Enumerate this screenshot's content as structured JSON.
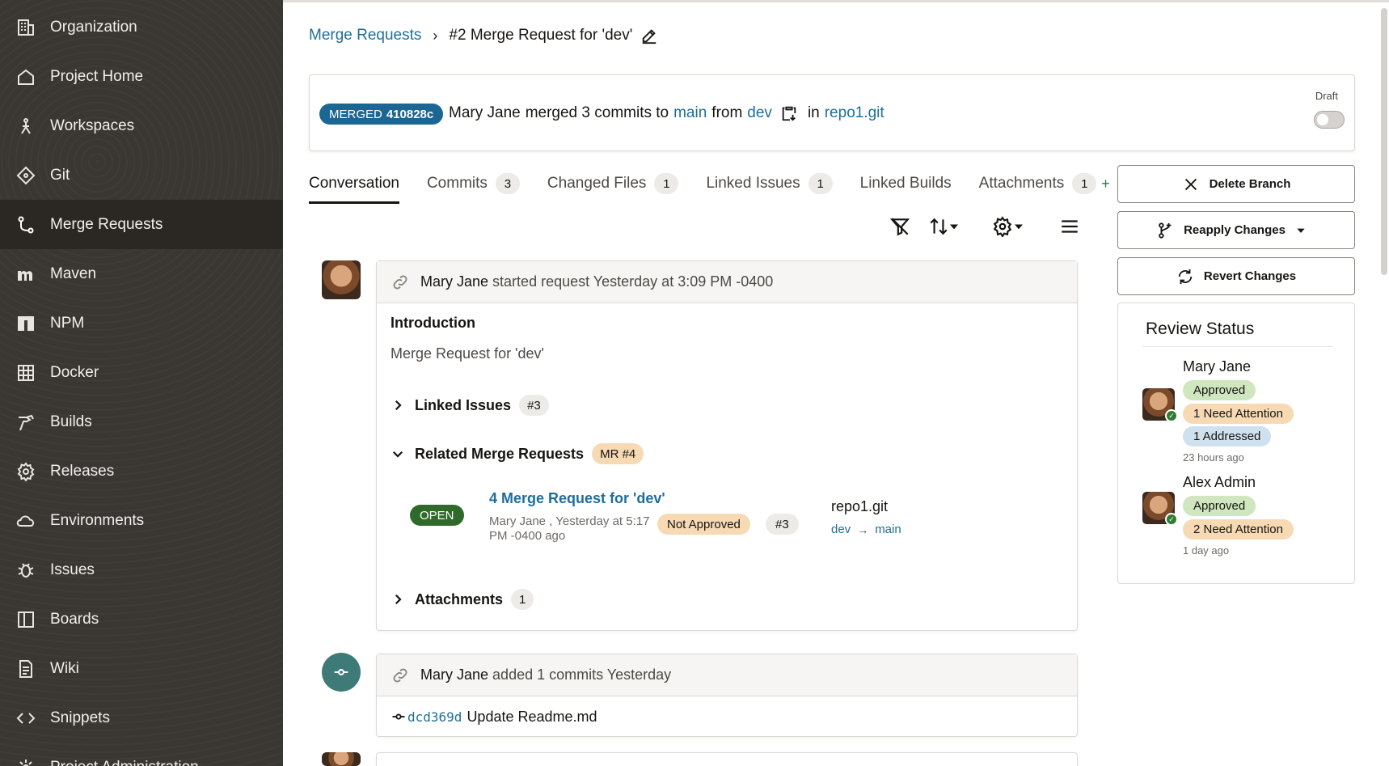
{
  "sidebar": {
    "items": [
      {
        "label": "Organization",
        "icon": "building-icon"
      },
      {
        "label": "Project Home",
        "icon": "home-icon"
      },
      {
        "label": "Workspaces",
        "icon": "workspace-icon"
      },
      {
        "label": "Git",
        "icon": "git-icon"
      },
      {
        "label": "Merge Requests",
        "icon": "merge-request-icon",
        "active": true
      },
      {
        "label": "Maven",
        "icon": "maven-icon"
      },
      {
        "label": "NPM",
        "icon": "npm-icon"
      },
      {
        "label": "Docker",
        "icon": "docker-icon"
      },
      {
        "label": "Builds",
        "icon": "hammer-icon"
      },
      {
        "label": "Releases",
        "icon": "gear-badge-icon"
      },
      {
        "label": "Environments",
        "icon": "cloud-icon"
      },
      {
        "label": "Issues",
        "icon": "bug-icon"
      },
      {
        "label": "Boards",
        "icon": "board-icon"
      },
      {
        "label": "Wiki",
        "icon": "document-icon"
      },
      {
        "label": "Snippets",
        "icon": "code-icon"
      },
      {
        "label": "Project Administration",
        "icon": "admin-gear-icon"
      }
    ]
  },
  "breadcrumb": {
    "parent": "Merge Requests",
    "separator": "›",
    "current": "#2 Merge Request for 'dev'"
  },
  "merge": {
    "status": "MERGED",
    "commit": "410828c",
    "author": "Mary Jane",
    "text_merged": "merged 3 commits to",
    "target": "main",
    "from_word": "from",
    "source": "dev",
    "in_word": "in",
    "repo": "repo1.git",
    "draft_label": "Draft"
  },
  "tabs": [
    {
      "label": "Conversation",
      "active": true
    },
    {
      "label": "Commits",
      "count": "3"
    },
    {
      "label": "Changed Files",
      "count": "1"
    },
    {
      "label": "Linked Issues",
      "count": "1"
    },
    {
      "label": "Linked Builds"
    },
    {
      "label": "Attachments",
      "count": "1"
    }
  ],
  "tab_plus": "+",
  "activity1": {
    "author": "Mary Jane",
    "action": "started request Yesterday at 3:09 PM -0400",
    "intro_title": "Introduction",
    "intro_text": "Merge Request for 'dev'",
    "linked_issues_label": "Linked Issues",
    "linked_issues_pill": "#3",
    "related_label": "Related Merge Requests",
    "related_pill": "MR #4",
    "related_mr": {
      "status": "OPEN",
      "title": "4 Merge Request for 'dev'",
      "meta": "Mary Jane , Yesterday at 5:17 PM -0400 ago",
      "approval": "Not Approved",
      "issue": "#3",
      "repo": "repo1.git",
      "source": "dev",
      "arrow": "→",
      "target": "main"
    },
    "attachments_label": "Attachments",
    "attachments_count": "1"
  },
  "activity2": {
    "author": "Mary Jane",
    "action": "added 1 commits Yesterday",
    "commit_hash": "dcd369d",
    "commit_msg": "Update Readme.md"
  },
  "actions": {
    "delete_branch": "Delete Branch",
    "reapply": "Reapply Changes",
    "revert": "Revert Changes"
  },
  "review": {
    "title": "Review Status",
    "reviewers": [
      {
        "name": "Mary Jane",
        "approved": "Approved",
        "attention": "1 Need Attention",
        "addressed": "1 Addressed",
        "time": "23 hours ago"
      },
      {
        "name": "Alex Admin",
        "approved": "Approved",
        "attention": "2 Need Attention",
        "time": "1 day ago"
      }
    ]
  },
  "colors": {
    "sidebar_bg": "#3a3631",
    "link": "#1e6e9b",
    "merged_badge": "#1b6693",
    "open_badge": "#2f6a2b"
  }
}
